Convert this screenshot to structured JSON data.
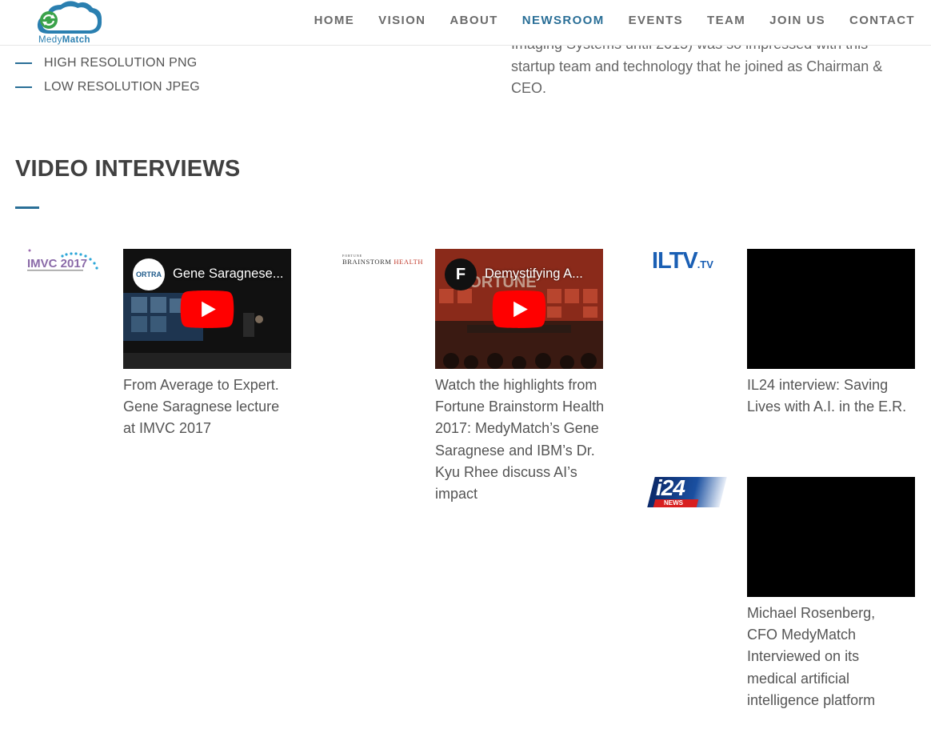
{
  "header": {
    "logo_text_a": "Medy",
    "logo_text_b": "Match",
    "nav": [
      {
        "label": "HOME",
        "active": false
      },
      {
        "label": "VISION",
        "active": false
      },
      {
        "label": "ABOUT",
        "active": false
      },
      {
        "label": "NEWSROOM",
        "active": true
      },
      {
        "label": "EVENTS",
        "active": false
      },
      {
        "label": "TEAM",
        "active": false
      },
      {
        "label": "JOIN US",
        "active": false
      },
      {
        "label": "CONTACT",
        "active": false
      }
    ]
  },
  "downloads": [
    {
      "label": "HIGH RESOLUTION PNG"
    },
    {
      "label": "LOW RESOLUTION JPEG"
    }
  ],
  "bio": {
    "text": "Imaging Systems until 2015) was so impressed with this startup team and technology that he joined as Chairman & CEO."
  },
  "section": {
    "title": "VIDEO INTERVIEWS"
  },
  "videos": [
    {
      "source_logo": "IMVC 2017",
      "player_title": "Gene Saragnese...",
      "channel_label": "ORTRA",
      "caption": "From Average to Expert. Gene Saragnese lecture at IMVC 2017"
    },
    {
      "source_logo_a": "FORTUNE",
      "source_logo_b": "BRAINSTORM",
      "source_logo_c": "HEALTH",
      "player_title": "Demystifying A...",
      "channel_label": "F",
      "caption": "Watch the highlights from Fortune Brainstorm Health 2017: MedyMatch’s Gene Saragnese and IBM’s Dr. Kyu Rhee discuss AI’s impact"
    },
    {
      "source_logo_a": "ILTV",
      "source_logo_b": ".TV",
      "caption": "IL24 interview: Saving Lives with A.I. in the E.R."
    },
    {
      "source_logo_a": "i24",
      "source_logo_b": "NEWS",
      "caption": "Michael Rosenberg, CFO MedyMatch Interviewed on its medical artificial intelligence platform"
    }
  ],
  "colors": {
    "accent": "#2a6f97",
    "youtube_red": "#ff0000",
    "text": "#555555",
    "heading": "#404040"
  }
}
